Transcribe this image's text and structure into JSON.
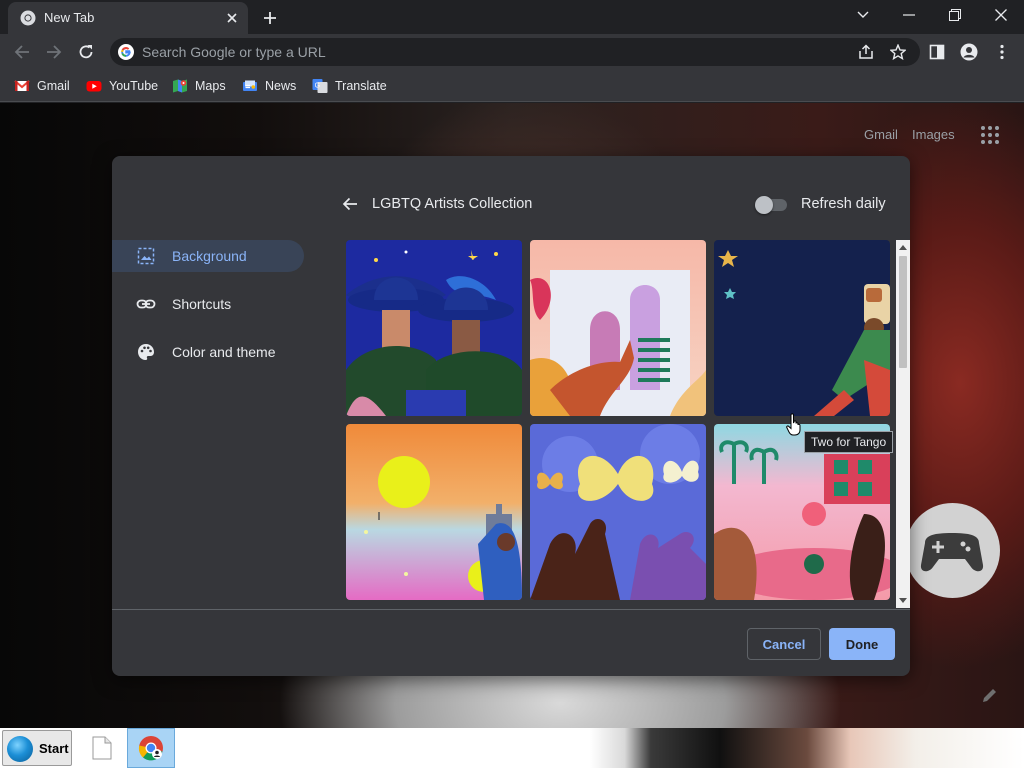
{
  "browser": {
    "tab": {
      "title": "New Tab"
    },
    "omnibox": {
      "placeholder": "Search Google or type a URL",
      "value": ""
    },
    "bookmarks": [
      {
        "label": "Gmail",
        "icon": "gmail-icon"
      },
      {
        "label": "YouTube",
        "icon": "youtube-icon"
      },
      {
        "label": "Maps",
        "icon": "maps-icon"
      },
      {
        "label": "News",
        "icon": "news-icon"
      },
      {
        "label": "Translate",
        "icon": "translate-icon"
      }
    ]
  },
  "ntp": {
    "links": {
      "gmail": "Gmail",
      "images": "Images"
    }
  },
  "dialog": {
    "sidebar": [
      {
        "label": "Background",
        "icon": "image-icon",
        "active": true
      },
      {
        "label": "Shortcuts",
        "icon": "link-icon",
        "active": false
      },
      {
        "label": "Color and theme",
        "icon": "palette-icon",
        "active": false
      }
    ],
    "collection_title": "LGBTQ Artists Collection",
    "refresh_label": "Refresh daily",
    "refresh_on": false,
    "tooltip": "Two for Tango",
    "cancel_label": "Cancel",
    "done_label": "Done"
  },
  "taskbar": {
    "start_label": "Start"
  },
  "colors": {
    "accent": "#8ab4f8",
    "dialog_bg": "#35363a",
    "active_item_bg": "#394457"
  }
}
